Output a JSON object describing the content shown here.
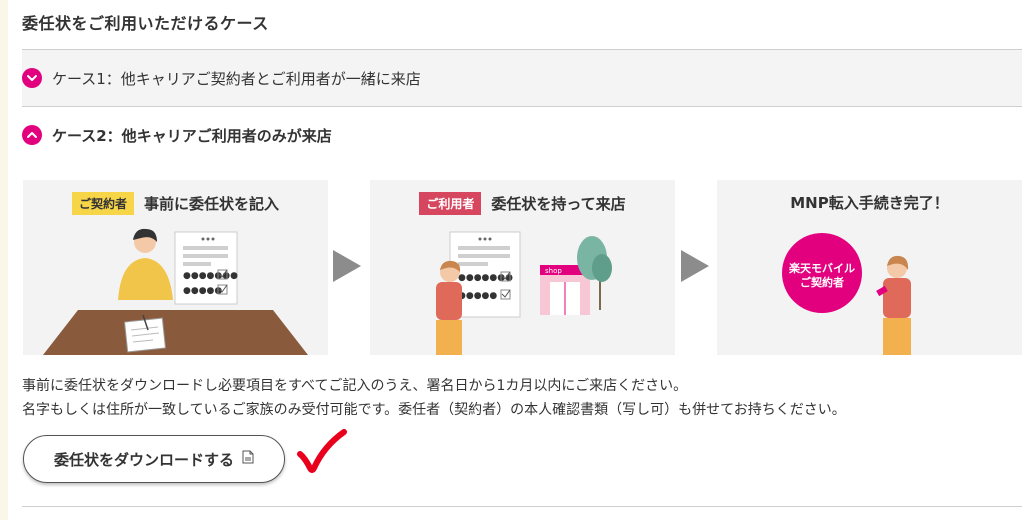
{
  "page": {
    "title": "委任状をご利用いただけるケース"
  },
  "cases": [
    {
      "label": "ケース1：他キャリアご契約者とご利用者が一緒に来店",
      "expanded": false
    },
    {
      "label": "ケース2：他キャリアご利用者のみが来店",
      "expanded": true
    }
  ],
  "steps": [
    {
      "tag": "ご契約者",
      "caption": "事前に委任状を記入"
    },
    {
      "tag": "ご利用者",
      "caption": "委任状を持って来店",
      "shop_sign": "shop"
    },
    {
      "caption": "MNP転入手続き完了！",
      "badge_line1": "楽天モバイル",
      "badge_line2": "ご契約者"
    }
  ],
  "notes": {
    "line1": "事前に委任状をダウンロードし必要項目をすべてご記入のうえ、署名日から1カ月以内にご来店ください。",
    "line2": "名字もしくは住所が一致しているご家族のみ受付可能です。委任者（契約者）の本人確認書類（写し可）も併せてお持ちください。"
  },
  "download_button": {
    "label": "委任状をダウンロードする",
    "icon": "document-icon"
  },
  "colors": {
    "accent": "#e3007f",
    "tag_yellow": "#f7d548",
    "tag_red": "#d6475f",
    "check_red": "#e8001c"
  }
}
